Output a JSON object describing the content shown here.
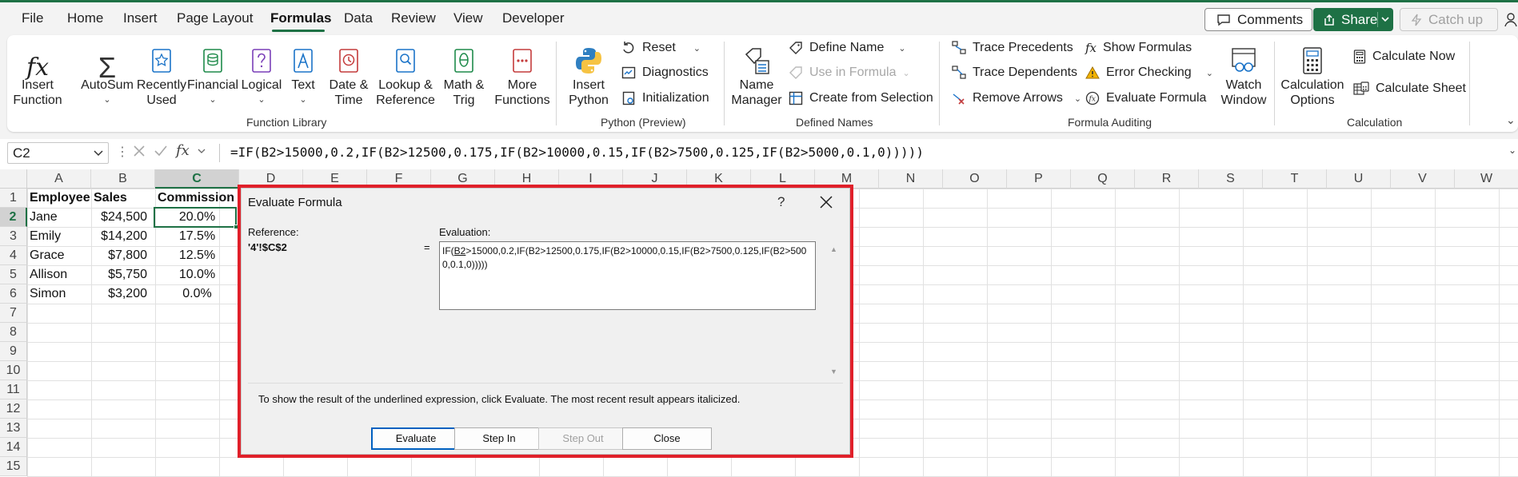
{
  "menu": {
    "tabs": [
      "File",
      "Home",
      "Insert",
      "Page Layout",
      "Formulas",
      "Data",
      "Review",
      "View",
      "Developer"
    ],
    "active_tab": "Formulas",
    "comments_label": "Comments",
    "share_label": "Share",
    "catchup_label": "Catch up"
  },
  "ribbon": {
    "function_library": {
      "label": "Function Library",
      "insert_function": [
        "Insert",
        "Function"
      ],
      "autosum": "AutoSum",
      "recently_used": [
        "Recently",
        "Used"
      ],
      "financial": "Financial",
      "logical": "Logical",
      "text": "Text",
      "date_time": [
        "Date &",
        "Time"
      ],
      "lookup_reference": [
        "Lookup &",
        "Reference"
      ],
      "math_trig": [
        "Math &",
        "Trig"
      ],
      "more_functions": [
        "More",
        "Functions"
      ]
    },
    "python": {
      "label": "Python (Preview)",
      "insert_python": [
        "Insert",
        "Python"
      ],
      "reset": "Reset",
      "diagnostics": "Diagnostics",
      "initialization": "Initialization"
    },
    "defined_names": {
      "label": "Defined Names",
      "name_manager": [
        "Name",
        "Manager"
      ],
      "define_name": "Define Name",
      "use_in_formula": "Use in Formula",
      "create_from_selection": "Create from Selection"
    },
    "formula_auditing": {
      "label": "Formula Auditing",
      "trace_precedents": "Trace Precedents",
      "trace_dependents": "Trace Dependents",
      "remove_arrows": "Remove Arrows",
      "show_formulas": "Show Formulas",
      "error_checking": "Error Checking",
      "evaluate_formula": "Evaluate Formula",
      "watch_window": [
        "Watch",
        "Window"
      ]
    },
    "calculation": {
      "label": "Calculation",
      "calculation_options": [
        "Calculation",
        "Options"
      ],
      "calculate_now": "Calculate Now",
      "calculate_sheet": "Calculate Sheet"
    }
  },
  "formula_bar": {
    "name_box": "C2",
    "fx": "fx",
    "formula": "=IF(B2>15000,0.2,IF(B2>12500,0.175,IF(B2>10000,0.15,IF(B2>7500,0.125,IF(B2>5000,0.1,0)))))"
  },
  "sheet": {
    "columns": [
      "A",
      "B",
      "C",
      "D",
      "E",
      "F",
      "G",
      "H",
      "I",
      "J",
      "K",
      "L",
      "M",
      "N",
      "O",
      "P",
      "Q",
      "R",
      "S",
      "T",
      "U",
      "V",
      "W"
    ],
    "rows": [
      "1",
      "2",
      "3",
      "4",
      "5",
      "6",
      "7",
      "8",
      "9",
      "10",
      "11",
      "12",
      "13",
      "14",
      "15"
    ],
    "headers": [
      "Employee",
      "Sales",
      "Commission"
    ],
    "data": [
      [
        "Jane",
        "$24,500",
        "20.0%"
      ],
      [
        "Emily",
        "$14,200",
        "17.5%"
      ],
      [
        "Grace",
        "$7,800",
        "12.5%"
      ],
      [
        "Allison",
        "$5,750",
        "10.0%"
      ],
      [
        "Simon",
        "$3,200",
        "0.0%"
      ]
    ]
  },
  "dialog": {
    "title": "Evaluate Formula",
    "help": "?",
    "reference_label": "Reference:",
    "reference_value": "'4'!$C$2",
    "equals": "=",
    "evaluation_label": "Evaluation:",
    "evaluation_pre": "IF(",
    "evaluation_underlined": "B2",
    "evaluation_post": ">15000,0.2,IF(B2>12500,0.175,IF(B2>10000,0.15,IF(B2>7500,0.125,IF(B2>5000,0.1,0)))))",
    "hint": "To show the result of the underlined expression, click Evaluate.  The most recent result appears italicized.",
    "buttons": {
      "evaluate": "Evaluate",
      "step_in": "Step In",
      "step_out": "Step Out",
      "close": "Close"
    }
  },
  "colors": {
    "accent": "#1e7145",
    "highlight_border": "#e0202a",
    "default_button": "#0060c0"
  }
}
